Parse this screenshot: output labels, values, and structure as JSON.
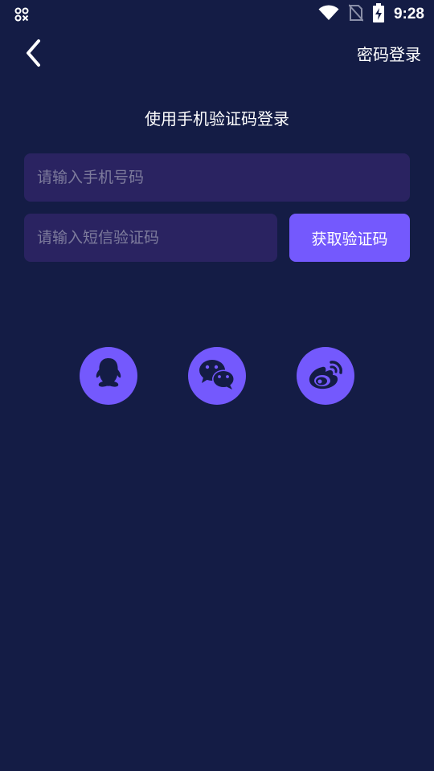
{
  "status_bar": {
    "time": "9:28",
    "icons": [
      "app-notification-icon",
      "wifi-icon",
      "no-sim-icon",
      "battery-charging-icon"
    ]
  },
  "header": {
    "back_icon": "chevron-left-icon",
    "password_login_label": "密码登录"
  },
  "main": {
    "title": "使用手机验证码登录",
    "phone_input": {
      "value": "",
      "placeholder": "请输入手机号码"
    },
    "code_input": {
      "value": "",
      "placeholder": "请输入短信验证码"
    },
    "get_code_label": "获取验证码"
  },
  "social_login": {
    "items": [
      {
        "icon": "qq-icon"
      },
      {
        "icon": "wechat-icon"
      },
      {
        "icon": "weibo-icon"
      }
    ]
  },
  "colors": {
    "background": "#141c45",
    "input_background": "#2a2361",
    "accent": "#7459fd",
    "placeholder": "#7d7b9c",
    "text": "#ffffff"
  }
}
